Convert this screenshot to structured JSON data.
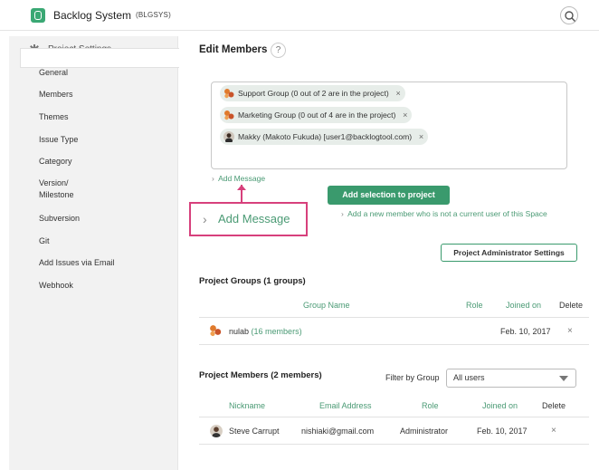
{
  "header": {
    "app_title": "Backlog System",
    "app_key": "(BLGSYS)",
    "search_icon": "search-icon"
  },
  "sidebar": {
    "heading": "Project Settings",
    "items": [
      {
        "label": "General"
      },
      {
        "label": "Members",
        "active": true
      },
      {
        "label": "Themes"
      },
      {
        "label": "Issue Type"
      },
      {
        "label": "Category"
      },
      {
        "label": "Version/\nMilestone"
      },
      {
        "label": "Subversion"
      },
      {
        "label": "Git"
      },
      {
        "label": "Add Issues via Email"
      },
      {
        "label": "Webhook"
      }
    ]
  },
  "main": {
    "title": "Edit Members",
    "help": "?",
    "selection": [
      {
        "label": "Support Group (0 out of 2 are in the project)",
        "icon": "group-icon"
      },
      {
        "label": "Marketing Group (0 out of 4 are in the project)",
        "icon": "group-icon"
      },
      {
        "label": "Makky (Makoto Fukuda) [user1@backlogtool.com)",
        "icon": "user-avatar-icon"
      }
    ],
    "chip_remove": "×",
    "add_message_link": "Add Message",
    "add_message_callout": "Add Message",
    "add_selection_button": "Add selection to project",
    "new_member_link": "Add a new member who is not a current user of this Space",
    "admin_settings_button": "Project Administrator Settings"
  },
  "project_groups": {
    "title": "Project Groups (1 groups)",
    "columns": {
      "name": "Group Name",
      "role": "Role",
      "joined": "Joined on",
      "delete": "Delete"
    },
    "rows": [
      {
        "name": "nulab",
        "members": "(16 members)",
        "joined": "Feb. 10, 2017",
        "delete": "×"
      }
    ]
  },
  "project_members": {
    "title": "Project Members (2 members)",
    "filter_label": "Filter by Group",
    "filter_value": "All users",
    "columns": {
      "nickname": "Nickname",
      "email": "Email Address",
      "role": "Role",
      "joined": "Joined on",
      "delete": "Delete"
    },
    "rows": [
      {
        "nickname": "Steve Carrupt",
        "email": "nishiaki@gmail.com",
        "role": "Administrator",
        "joined": "Feb. 10, 2017",
        "delete": "×"
      }
    ]
  },
  "colors": {
    "accent": "#3a9a6d",
    "link": "#4a9a74",
    "callout": "#d7407c"
  }
}
